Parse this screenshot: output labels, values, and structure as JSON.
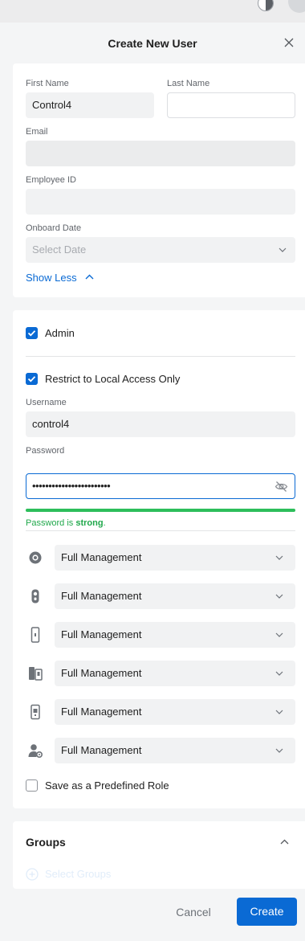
{
  "dialog": {
    "title": "Create New User"
  },
  "profile": {
    "first_name_label": "First Name",
    "first_name_value": "Control4",
    "last_name_label": "Last Name",
    "last_name_value": "",
    "email_label": "Email",
    "email_value": "",
    "employee_id_label": "Employee ID",
    "employee_id_value": "",
    "onboard_date_label": "Onboard Date",
    "onboard_date_placeholder": "Select Date",
    "show_less_label": "Show Less"
  },
  "access": {
    "admin_label": "Admin",
    "admin_checked": true,
    "restrict_label": "Restrict to Local Access Only",
    "restrict_checked": true,
    "username_label": "Username",
    "username_value": "control4",
    "password_label": "Password",
    "password_value": "••••••••••••••••••••••••",
    "strength_prefix": "Password is",
    "strength_word": "strong",
    "strength_suffix": ".",
    "strength_color": "#2dbe5b",
    "permissions": [
      {
        "icon": "camera-icon",
        "value": "Full Management"
      },
      {
        "icon": "doorbell-icon",
        "value": "Full Management"
      },
      {
        "icon": "access-reader-icon",
        "value": "Full Management"
      },
      {
        "icon": "intercom-icon",
        "value": "Full Management"
      },
      {
        "icon": "keypad-icon",
        "value": "Full Management"
      },
      {
        "icon": "user-settings-icon",
        "value": "Full Management"
      }
    ],
    "predefined_role_label": "Save as a Predefined Role",
    "predefined_role_checked": false
  },
  "groups": {
    "title": "Groups",
    "select_label": "Select Groups"
  },
  "footer": {
    "cancel_label": "Cancel",
    "create_label": "Create"
  },
  "colors": {
    "accent": "#0a6ad4",
    "success": "#2dbe5b"
  }
}
